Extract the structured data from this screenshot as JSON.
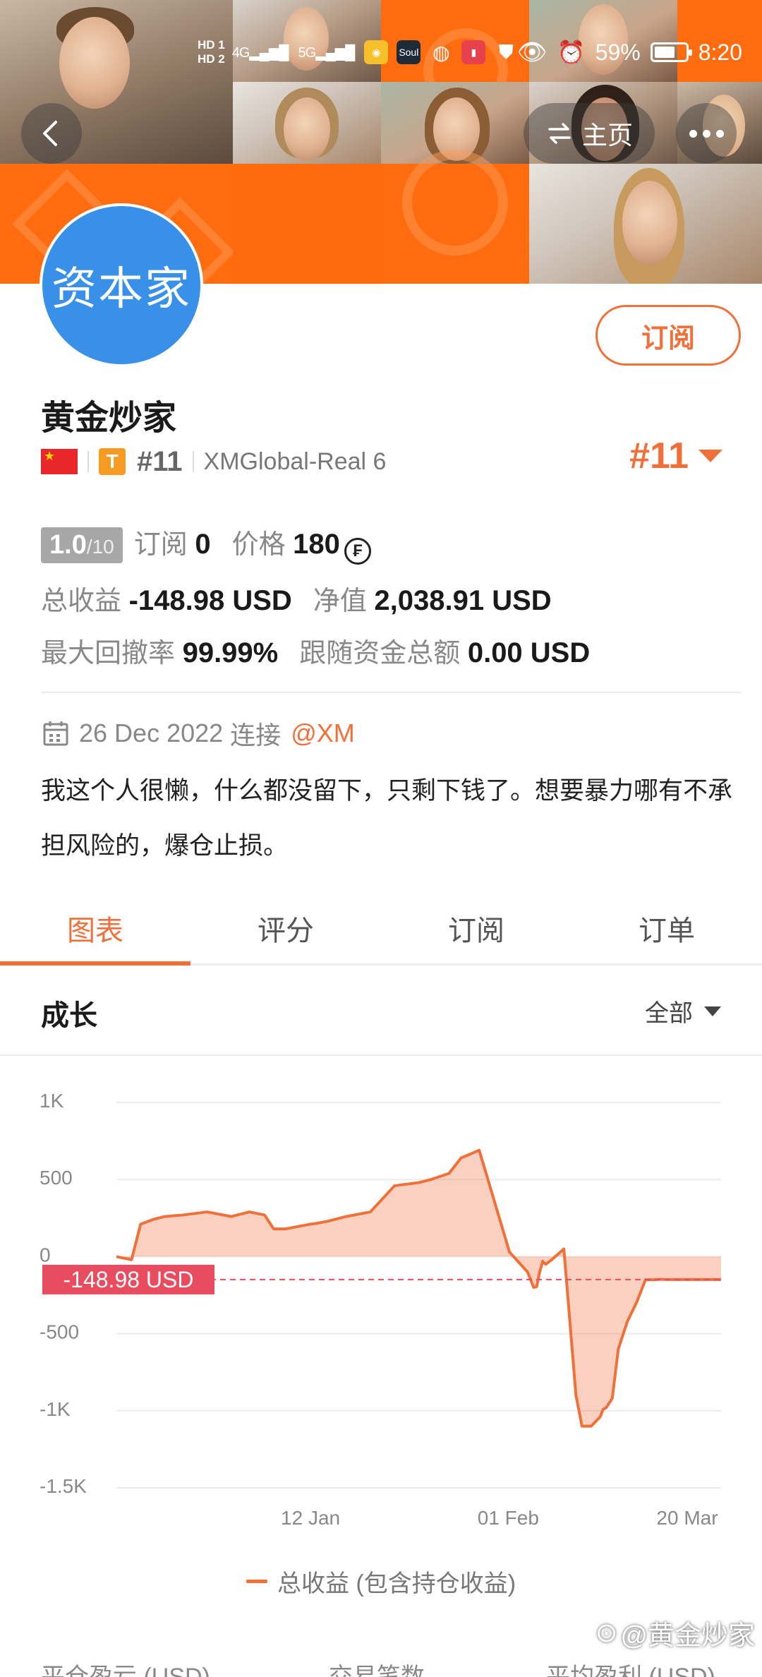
{
  "status_bar": {
    "hd1": "HD 1",
    "hd2": "HD 2",
    "signal1": "4G",
    "signal2": "5G",
    "app_soul": "Soul",
    "battery": "59%",
    "time": "8:20"
  },
  "nav": {
    "home_label": "主页"
  },
  "profile": {
    "avatar_text": "资本家",
    "subscribe_label": "订阅",
    "name": "黄金炒家",
    "tier_badge": "T",
    "rank": "#11",
    "server": "XMGlobal-Real 6",
    "rank_right": "#11"
  },
  "stats": {
    "score_main": "1.0",
    "score_total": "/10",
    "subscribe_label": "订阅",
    "subscribe_count": "0",
    "price_label": "价格",
    "price_value": "180",
    "coin_symbol": "₣",
    "total_profit_label": "总收益",
    "total_profit_value": "-148.98 USD",
    "equity_label": "净值",
    "equity_value": "2,038.91 USD",
    "max_drawdown_label": "最大回撤率",
    "max_drawdown_value": "99.99%",
    "follow_total_label": "跟随资金总额",
    "follow_total_value": "0.00 USD"
  },
  "join": {
    "date": "26 Dec 2022",
    "connect_label": "连接",
    "broker": "@XM"
  },
  "bio": "我这个人很懒，什么都没留下，只剩下钱了。想要暴力哪有不承担风险的，爆仓止损。",
  "tabs": [
    {
      "label": "图表",
      "active": true
    },
    {
      "label": "评分",
      "active": false
    },
    {
      "label": "订阅",
      "active": false
    },
    {
      "label": "订单",
      "active": false
    }
  ],
  "section": {
    "title": "成长",
    "range": "全部"
  },
  "chart_data": {
    "type": "area",
    "title": "成长",
    "ylabel": "",
    "xlabel": "",
    "yticks": [
      "1K",
      "500",
      "0",
      "-500",
      "-1K",
      "-1.5K"
    ],
    "ytick_values": [
      1000,
      500,
      0,
      -500,
      -1000,
      -1500
    ],
    "ylim": [
      -1500,
      1000
    ],
    "xticks": [
      {
        "label": "12 Jan",
        "pos": 0.321
      },
      {
        "label": "01 Feb",
        "pos": 0.648
      },
      {
        "label": "20 Mar",
        "pos": 0.944
      }
    ],
    "current_value_label": "-148.98 USD",
    "current_value": -148.98,
    "series": [
      {
        "name": "总收益 (包含持仓收益)",
        "color": "#f0703a",
        "x": [
          0.0,
          0.025,
          0.04,
          0.06,
          0.08,
          0.11,
          0.15,
          0.19,
          0.22,
          0.245,
          0.26,
          0.28,
          0.3,
          0.32,
          0.33,
          0.35,
          0.38,
          0.42,
          0.46,
          0.5,
          0.52,
          0.535,
          0.55,
          0.57,
          0.6,
          0.65,
          0.68,
          0.69,
          0.695,
          0.7,
          0.705,
          0.71,
          0.72,
          0.74,
          0.76,
          0.77,
          0.785,
          0.795,
          0.8,
          0.805,
          0.81,
          0.815,
          0.82,
          0.83,
          0.845,
          0.86,
          0.875,
          0.89,
          0.9,
          0.91,
          0.915,
          0.93,
          0.945,
          0.96,
          0.975,
          1.0
        ],
        "values": [
          0,
          -20,
          210,
          240,
          260,
          270,
          290,
          260,
          290,
          270,
          180,
          180,
          195,
          210,
          215,
          230,
          260,
          290,
          460,
          480,
          500,
          520,
          540,
          640,
          690,
          30,
          -100,
          -200,
          -195,
          -100,
          -30,
          -50,
          -20,
          50,
          -900,
          -1100,
          -1100,
          -1060,
          -1040,
          -990,
          -980,
          -950,
          -920,
          -600,
          -420,
          -300,
          -150,
          -150,
          -147,
          -148.98,
          -148.98,
          -148.98,
          -148.98,
          -148.98,
          -148.98,
          -148.98
        ]
      }
    ]
  },
  "legend_label": "总收益 (包含持仓收益)",
  "bottom_labels": [
    "平仓盈亏 (USD)",
    "交易笔数",
    "平均盈利 (USD)"
  ],
  "watermark": "@黄金炒家",
  "colors": {
    "accent": "#f0703a",
    "banner_orange": "#ff6b0f",
    "avatar_blue": "#3890e8",
    "loss_label": "#e94b5f"
  }
}
